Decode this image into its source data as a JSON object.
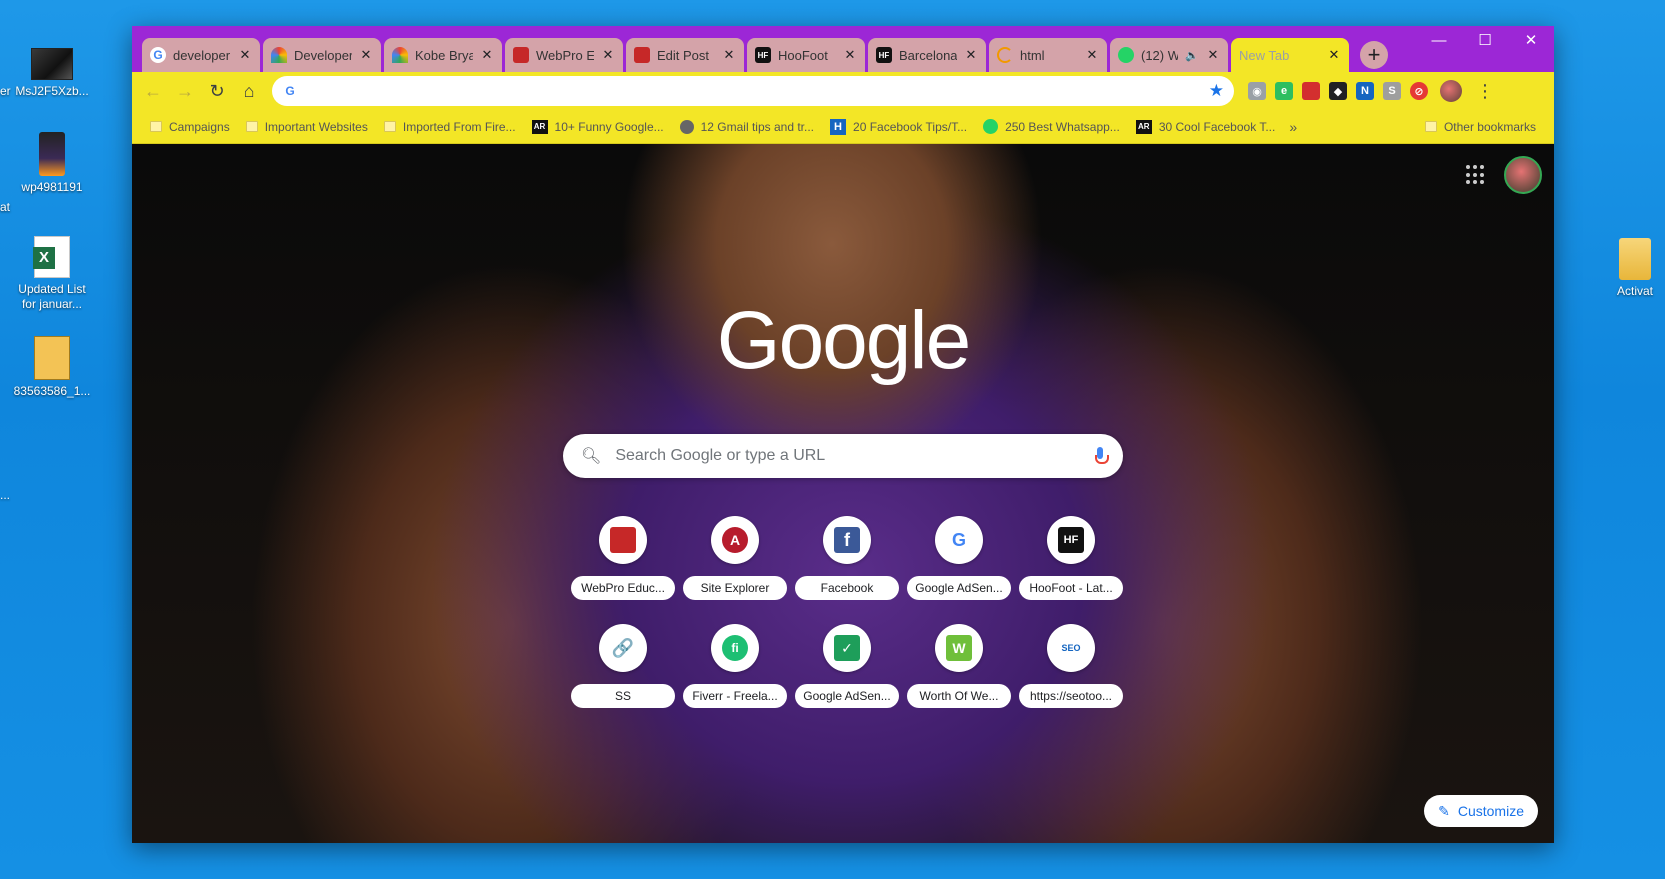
{
  "desktop": {
    "icons": [
      {
        "label": "MsJ2F5Xzb..."
      },
      {
        "label": "wp4981191"
      },
      {
        "label": "Updated List\nfor januar..."
      },
      {
        "label": "83563586_1..."
      },
      {
        "label": "Activat"
      }
    ],
    "edge_fragments": [
      "er",
      "at",
      "..."
    ]
  },
  "browser": {
    "tabs": [
      {
        "title": "developer",
        "icon": "google-g-icon"
      },
      {
        "title": "Developer",
        "icon": "rainbow-icon"
      },
      {
        "title": "Kobe Brya",
        "icon": "rainbow-icon"
      },
      {
        "title": "WebPro E",
        "icon": "webpro-icon"
      },
      {
        "title": "Edit Post",
        "icon": "webpro-icon"
      },
      {
        "title": "HooFoot",
        "icon": "hoofoot-icon"
      },
      {
        "title": "Barcelona",
        "icon": "hoofoot-icon"
      },
      {
        "title": "html",
        "icon": "loading-icon"
      },
      {
        "title": "(12) W",
        "icon": "whatsapp-icon"
      },
      {
        "title": "New Tab",
        "icon": "none",
        "active": true
      }
    ],
    "new_tab_symbol": "+",
    "window_controls": {
      "minimize": "—",
      "maximize": "☐",
      "close": "✕"
    },
    "omnibox": {
      "value": "",
      "placeholder": ""
    },
    "bookmarks": [
      {
        "label": "Campaigns",
        "icon": "folder-icon"
      },
      {
        "label": "Important Websites",
        "icon": "folder-icon"
      },
      {
        "label": "Imported From Fire...",
        "icon": "folder-icon"
      },
      {
        "label": "10+ Funny Google...",
        "icon": "ar-icon"
      },
      {
        "label": "12 Gmail tips and tr...",
        "icon": "globe-icon"
      },
      {
        "label": "20 Facebook Tips/T...",
        "icon": "h-icon"
      },
      {
        "label": "250 Best Whatsapp...",
        "icon": "whatsapp-icon"
      },
      {
        "label": "30 Cool Facebook T...",
        "icon": "ar-icon"
      }
    ],
    "bookmarks_more": "»",
    "other_bookmarks": "Other bookmarks"
  },
  "ntp": {
    "logo": "Google",
    "search_placeholder": "Search Google or type a URL",
    "shortcuts": [
      {
        "label": "WebPro Educ...",
        "color": "#c62828",
        "glyph": ""
      },
      {
        "label": "Site Explorer",
        "color": "#b71c2c",
        "glyph": "A"
      },
      {
        "label": "Facebook",
        "color": "#3b5998",
        "glyph": "f"
      },
      {
        "label": "Google AdSen...",
        "color": "#ffffff",
        "glyph": "G"
      },
      {
        "label": "HooFoot - Lat...",
        "color": "#111111",
        "glyph": "HF"
      },
      {
        "label": "SS",
        "color": "#ffffff",
        "glyph": "🔗"
      },
      {
        "label": "Fiverr - Freela...",
        "color": "#1dbf73",
        "glyph": "fi"
      },
      {
        "label": "Google AdSen...",
        "color": "#1e9e5a",
        "glyph": "✓"
      },
      {
        "label": "Worth Of We...",
        "color": "#6fbf3a",
        "glyph": "W"
      },
      {
        "label": "https://seotoo...",
        "color": "#ffffff",
        "glyph": "SEO"
      }
    ],
    "customize_label": "Customize"
  },
  "colors": {
    "tabstrip": "#9c27d6",
    "toolbar": "#f3e626",
    "inactive_tab": "#d4a3a9",
    "accent": "#1a73e8"
  }
}
